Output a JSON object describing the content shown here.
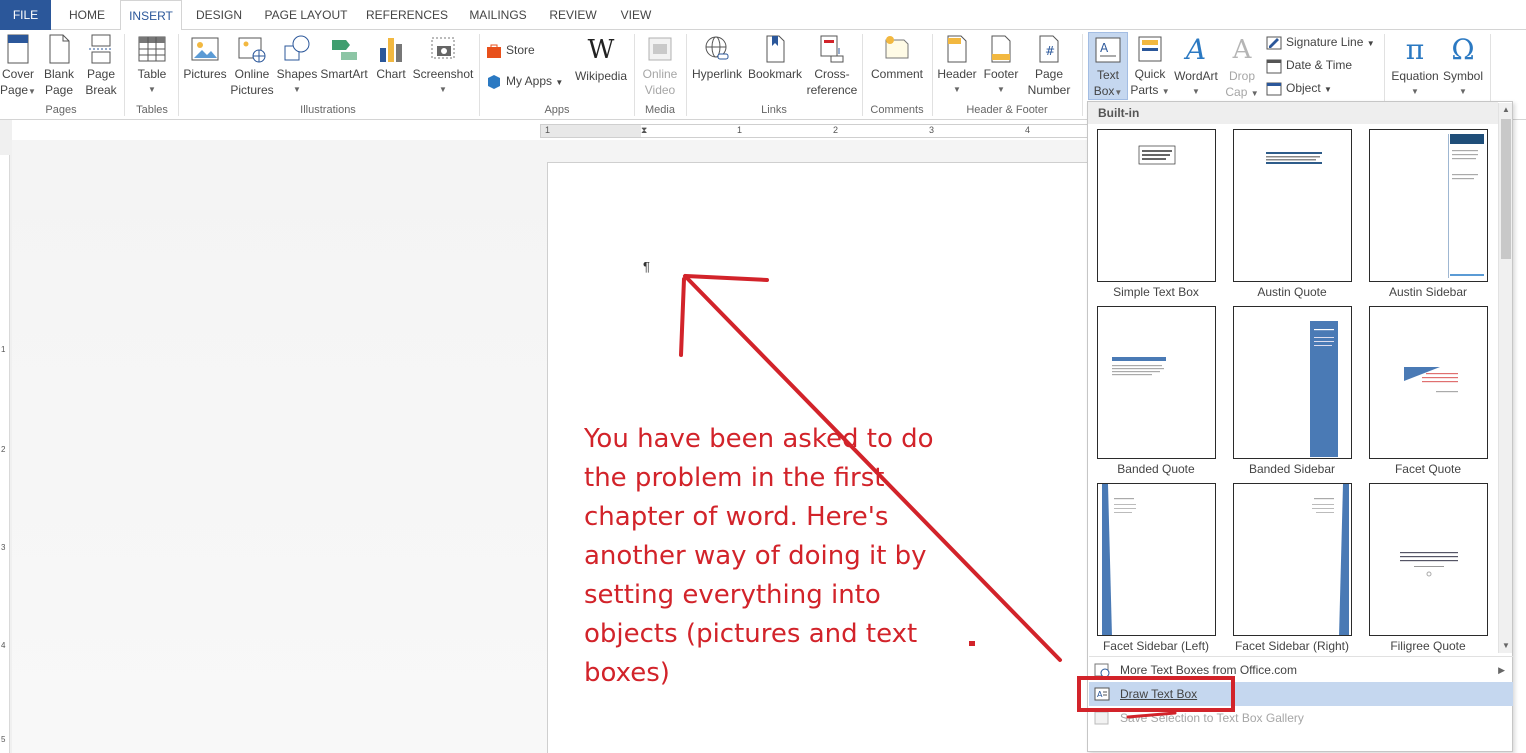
{
  "tabs": [
    {
      "label": "FILE"
    },
    {
      "label": "HOME"
    },
    {
      "label": "INSERT"
    },
    {
      "label": "DESIGN"
    },
    {
      "label": "PAGE LAYOUT"
    },
    {
      "label": "REFERENCES"
    },
    {
      "label": "MAILINGS"
    },
    {
      "label": "REVIEW"
    },
    {
      "label": "VIEW"
    }
  ],
  "ribbon": {
    "pages": {
      "group": "Pages",
      "cover_l1": "Cover",
      "cover_l2": "Page",
      "blank_l1": "Blank",
      "blank_l2": "Page",
      "break_l1": "Page",
      "break_l2": "Break"
    },
    "tables": {
      "group": "Tables",
      "table": "Table"
    },
    "illustrations": {
      "group": "Illustrations",
      "pictures": "Pictures",
      "online_l1": "Online",
      "online_l2": "Pictures",
      "shapes": "Shapes",
      "smartart": "SmartArt",
      "chart": "Chart",
      "screenshot": "Screenshot"
    },
    "apps": {
      "group": "Apps",
      "store": "Store",
      "myapps": "My Apps",
      "wikipedia": "Wikipedia"
    },
    "media": {
      "group": "Media",
      "video_l1": "Online",
      "video_l2": "Video"
    },
    "links": {
      "group": "Links",
      "hyperlink": "Hyperlink",
      "bookmark": "Bookmark",
      "cross_l1": "Cross-",
      "cross_l2": "reference"
    },
    "comments": {
      "group": "Comments",
      "comment": "Comment"
    },
    "header_footer": {
      "group": "Header & Footer",
      "header": "Header",
      "footer": "Footer",
      "pagenum_l1": "Page",
      "pagenum_l2": "Number"
    },
    "text": {
      "textbox_l1": "Text",
      "textbox_l2": "Box",
      "quickparts_l1": "Quick",
      "quickparts_l2": "Parts",
      "wordart": "WordArt",
      "dropcap_l1": "Drop",
      "dropcap_l2": "Cap",
      "signature": "Signature Line",
      "datetime": "Date & Time",
      "object": "Object"
    },
    "symbols": {
      "equation": "Equation",
      "symbol": "Symbol"
    }
  },
  "ruler": {
    "ticks": [
      "1",
      "1",
      "1",
      "2",
      "3",
      "4"
    ]
  },
  "vruler": {
    "ticks": [
      "1",
      "1",
      "2",
      "3",
      "4",
      "5"
    ]
  },
  "document": {
    "pilcrow": "¶",
    "annotation_lines": [
      "You have been asked to do",
      "the problem in the first",
      "chapter of word. Here's",
      "another way of doing it by",
      "setting everything into",
      "objects (pictures and text",
      "boxes)"
    ]
  },
  "gallery": {
    "header": "Built-in",
    "items": [
      {
        "label": "Simple Text Box"
      },
      {
        "label": "Austin Quote"
      },
      {
        "label": "Austin Sidebar"
      },
      {
        "label": "Banded Quote"
      },
      {
        "label": "Banded Sidebar"
      },
      {
        "label": "Facet Quote"
      },
      {
        "label": "Facet Sidebar (Left)"
      },
      {
        "label": "Facet Sidebar (Right)"
      },
      {
        "label": "Filigree Quote"
      }
    ],
    "menu": {
      "more": "More Text Boxes from Office.com",
      "draw": "Draw Text Box",
      "save": "Save Selection to Text Box Gallery"
    }
  },
  "colors": {
    "accent": "#2b579a",
    "annotation": "#d2232a",
    "highlight": "#c5d7ef"
  }
}
